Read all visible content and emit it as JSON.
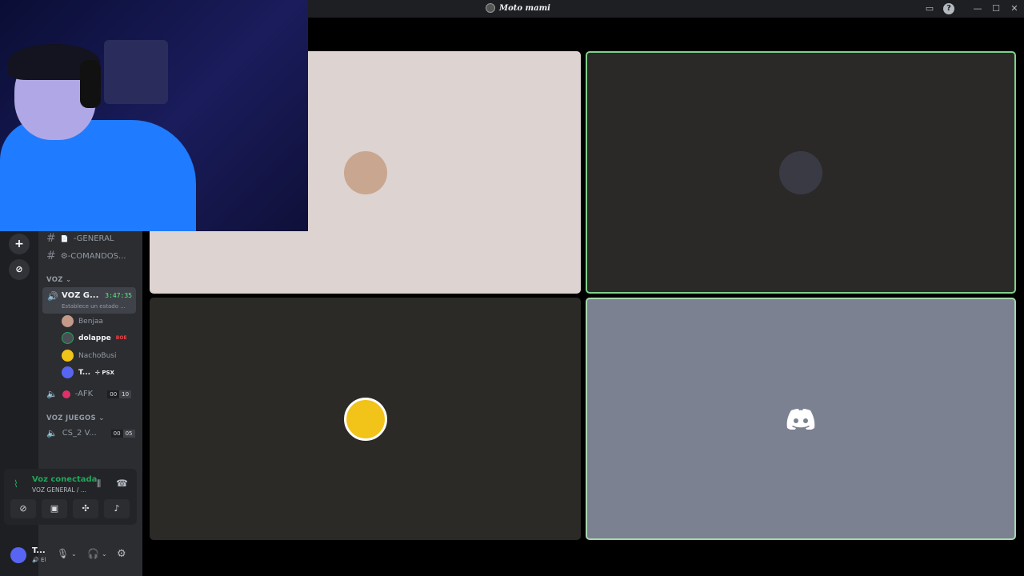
{
  "window": {
    "title": "Moto mami",
    "inbox_icon": "inbox-icon",
    "help_icon": "?",
    "minimize": "—",
    "maximize": "☐",
    "close": "✕"
  },
  "servers": {
    "add_icon": "+",
    "discover_icon": "⊘"
  },
  "channels": {
    "text": [
      {
        "label": "-GENERAL",
        "prefix": "📄"
      },
      {
        "label": "⚙-COMANDOS..."
      }
    ],
    "voice_category": "VOZ",
    "active_voice": {
      "name": "VOZ G...",
      "timer": "3:47:35",
      "status": "Establece un estado ..."
    },
    "members": [
      {
        "name": "Benjaa",
        "color": "#c49a8a"
      },
      {
        "name": "dolappe",
        "badge": "BOE",
        "color": "#4a4f55"
      },
      {
        "name": "NachoBusi",
        "color": "#f0c419"
      },
      {
        "name": "T...",
        "tag": "✢ PSX",
        "color": "#5865f2"
      }
    ],
    "afk": {
      "name": "-AFK",
      "count_a": "00",
      "count_b": "10"
    },
    "games_category": "VOZ JUEGOS",
    "games_channel": {
      "name": "CS_2 V...",
      "count_a": "00",
      "count_b": "05"
    }
  },
  "voice_panel": {
    "title": "Voz conectada",
    "subtitle": "VOZ GENERAL / ...",
    "buttons": [
      "camera-off-icon",
      "screen-share-icon",
      "activities-icon",
      "soundboard-icon"
    ]
  },
  "user": {
    "name": "T...",
    "status": "🔊 El"
  },
  "tiles": [
    {
      "background": "#ddd3d0",
      "avatar_color": "#c9a68f"
    },
    {
      "background": "#2b2928",
      "avatar_color": "#3a3a44",
      "speaking_border": "#7fd18a"
    },
    {
      "background": "#2b2a27",
      "avatar_color": "#f2c318"
    },
    {
      "background": "#7b8191",
      "avatar_color": "#ffffff"
    }
  ]
}
